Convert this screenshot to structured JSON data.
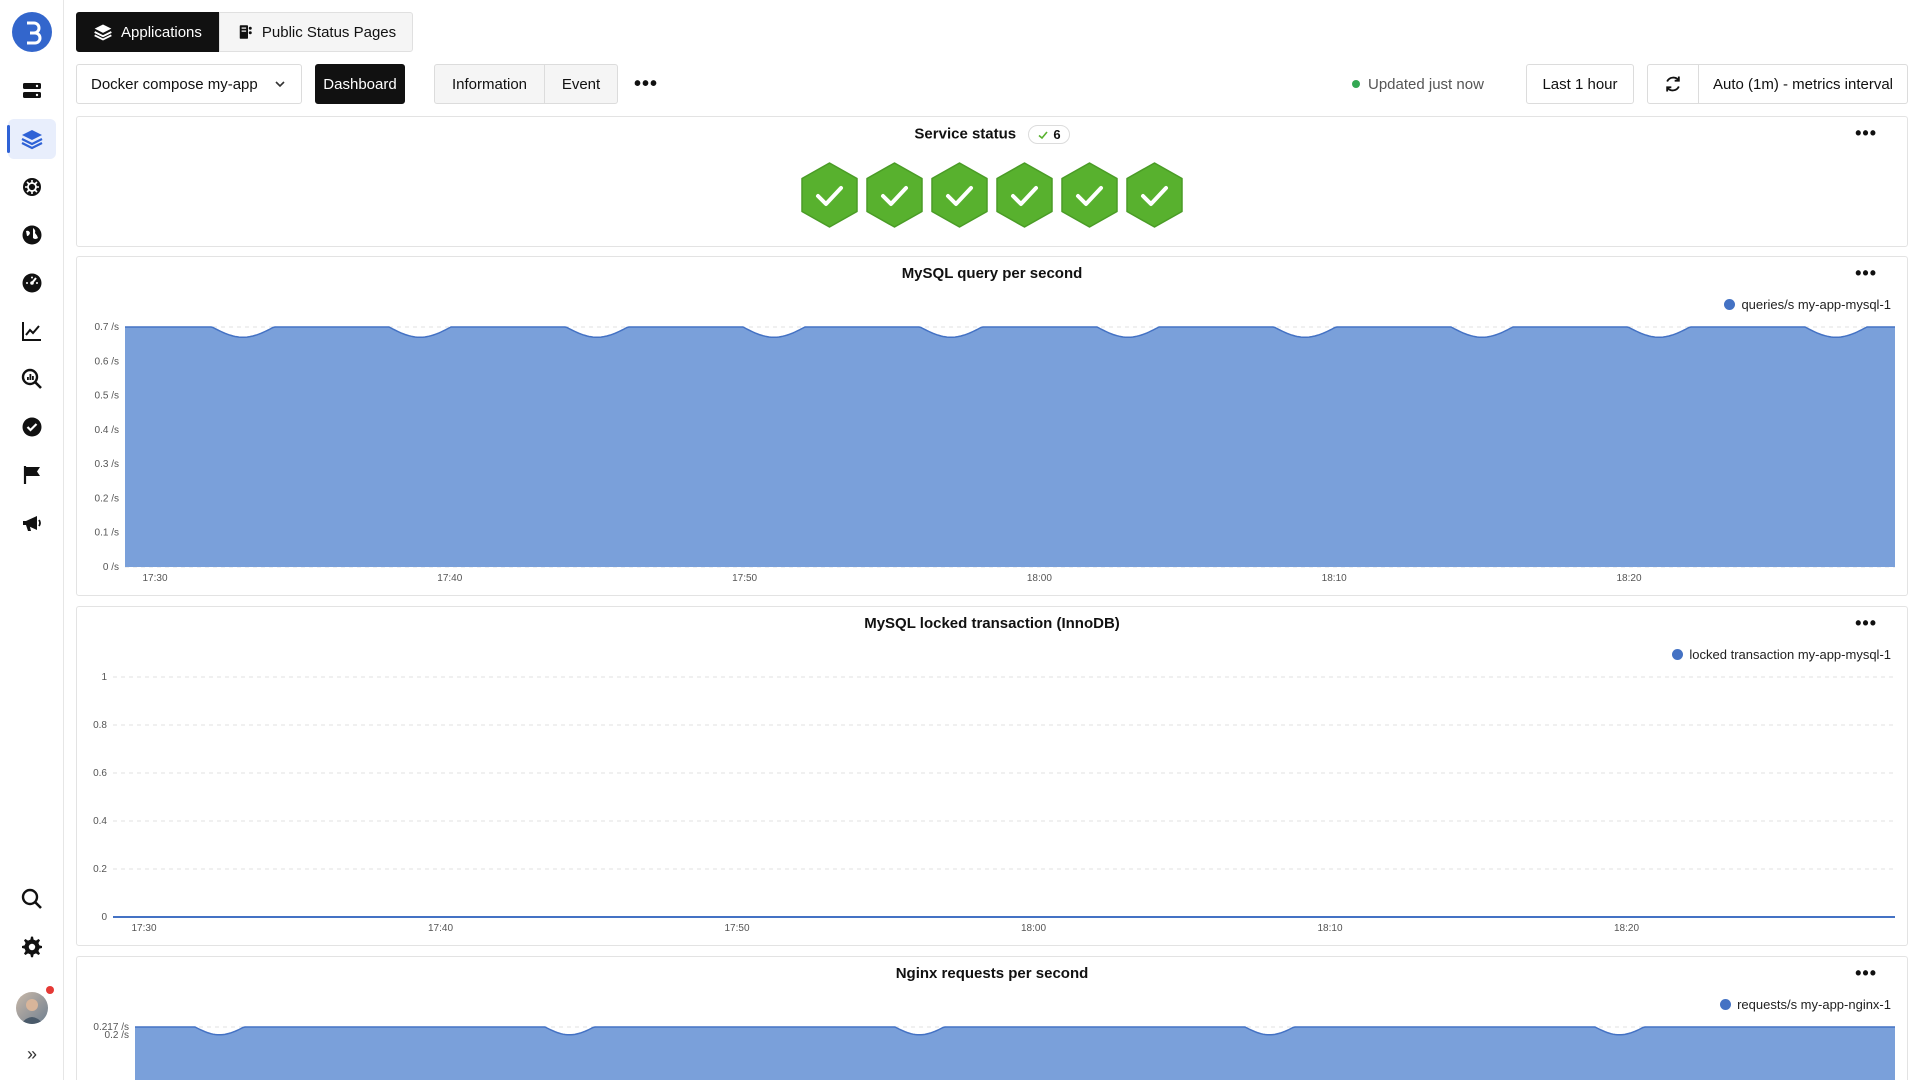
{
  "top_tabs": [
    {
      "label": "Applications",
      "icon": "layers-icon"
    },
    {
      "label": "Public Status Pages",
      "icon": "status-page-icon"
    }
  ],
  "toolbar": {
    "app_select": "Docker compose my-app",
    "dashboard_label": "Dashboard",
    "information_label": "Information",
    "event_label": "Event",
    "more_label": "•••",
    "updated_label": "Updated just now",
    "range_label": "Last 1 hour",
    "interval_label": "Auto (1m) - metrics interval"
  },
  "colors": {
    "accent": "#2f62d6",
    "series": "#4472c4",
    "area": "#7aa0da",
    "ok": "#58b12e"
  },
  "service_status": {
    "title": "Service status",
    "count": "6",
    "services": [
      "ok",
      "ok",
      "ok",
      "ok",
      "ok",
      "ok"
    ]
  },
  "panels": {
    "mysql_qps": {
      "title": "MySQL query per second",
      "menu": "•••"
    },
    "mysql_locked": {
      "title": "MySQL locked transaction (InnoDB)",
      "menu": "•••"
    },
    "nginx_rps": {
      "title": "Nginx requests per second",
      "menu": "•••"
    }
  },
  "chart_data": [
    {
      "type": "area",
      "title": "MySQL query per second",
      "series": [
        {
          "name": "queries/s my-app-mysql-1",
          "pattern": "periodic",
          "high": 0.7,
          "low": 0.67,
          "period_minutes": 6
        }
      ],
      "x_ticks": [
        "17:30",
        "17:40",
        "17:50",
        "18:00",
        "18:10",
        "18:20"
      ],
      "y_ticks": [
        "0 /s",
        "0.1 /s",
        "0.2 /s",
        "0.3 /s",
        "0.4 /s",
        "0.5 /s",
        "0.6 /s",
        "0.7 /s"
      ],
      "ylim": [
        0,
        0.7
      ],
      "x_range": [
        "17:29",
        "18:29"
      ],
      "grid": true
    },
    {
      "type": "line",
      "title": "MySQL locked transaction (InnoDB)",
      "series": [
        {
          "name": "locked transaction my-app-mysql-1",
          "constant": 0
        }
      ],
      "x_ticks": [
        "17:30",
        "17:40",
        "17:50",
        "18:00",
        "18:10",
        "18:20"
      ],
      "y_ticks": [
        "0",
        "0.2",
        "0.4",
        "0.6",
        "0.8",
        "1"
      ],
      "ylim": [
        0,
        1
      ],
      "grid": true
    },
    {
      "type": "area",
      "title": "Nginx requests per second",
      "series": [
        {
          "name": "requests/s my-app-nginx-1",
          "pattern": "periodic",
          "high": 0.217,
          "low": 0.2,
          "period_minutes": 12
        }
      ],
      "y_ticks": [
        "0.217 /s",
        "0.2 /s"
      ],
      "ylim": [
        0,
        0.217
      ],
      "grid": true
    }
  ]
}
